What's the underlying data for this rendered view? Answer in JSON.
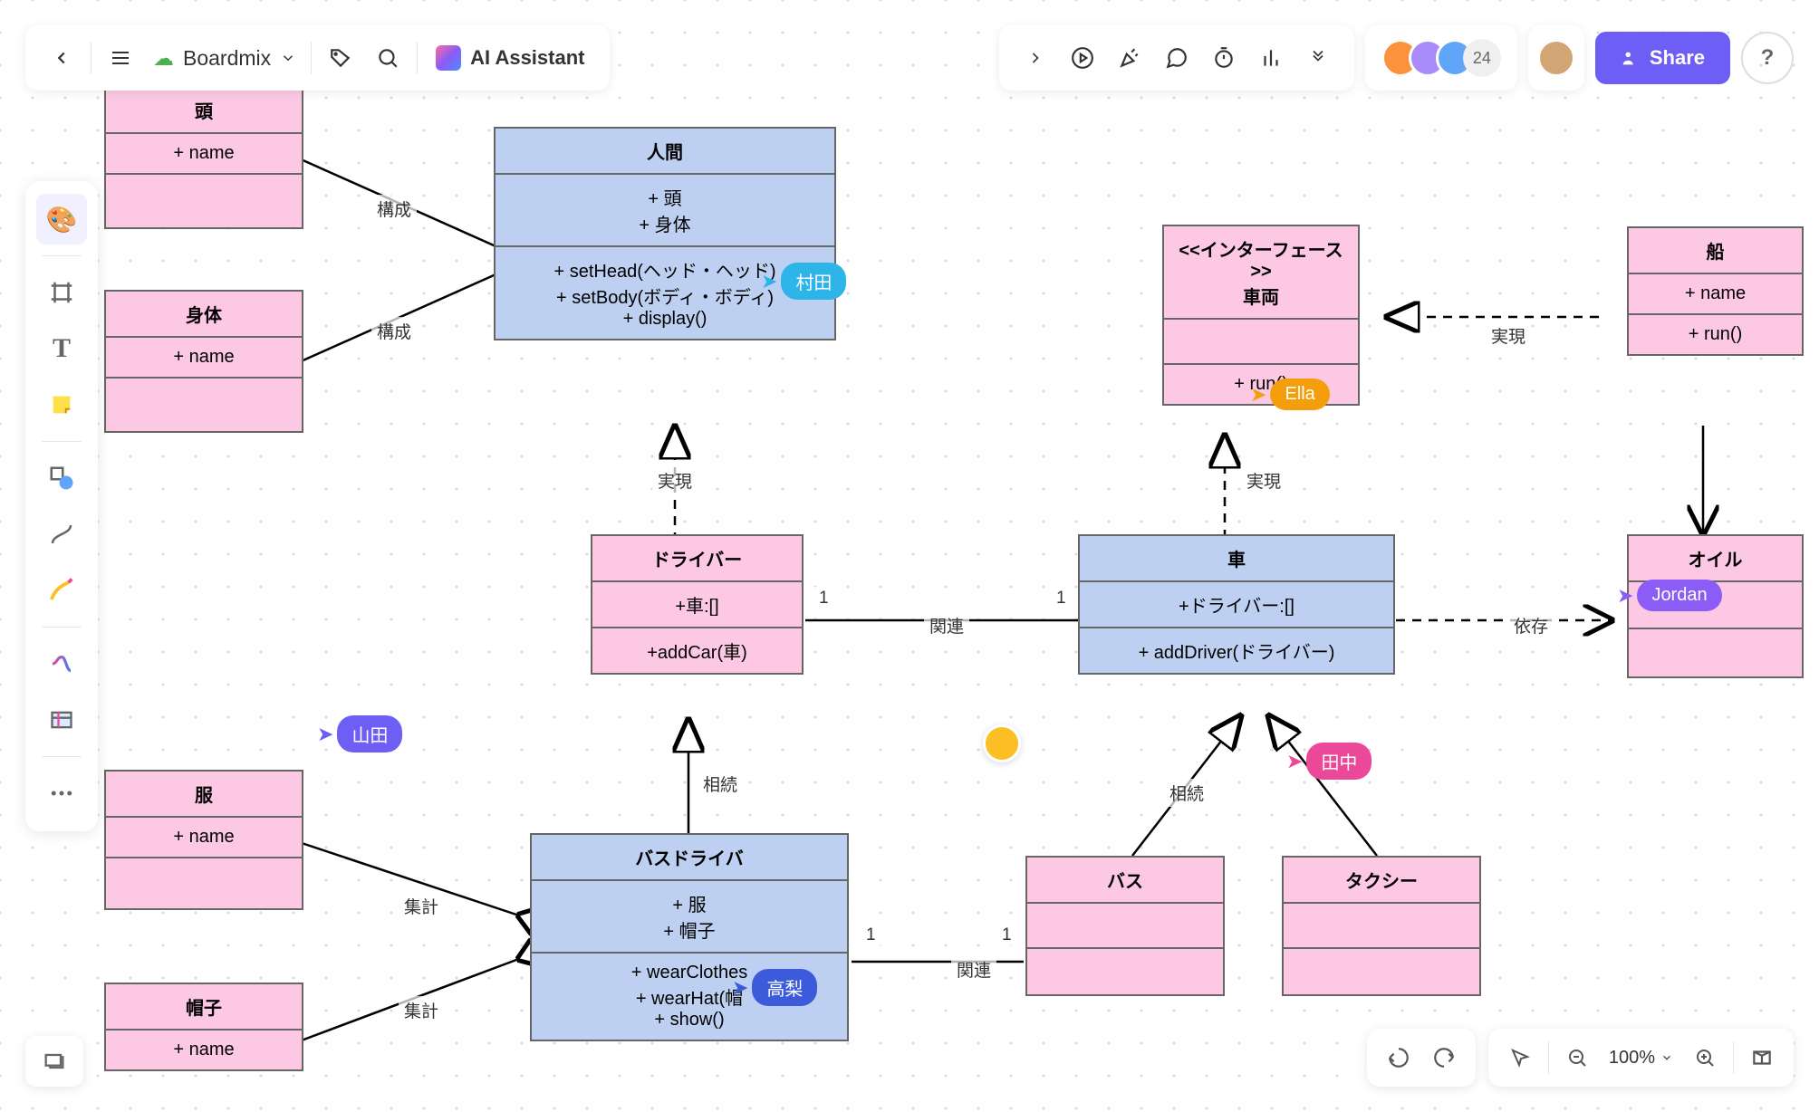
{
  "app": {
    "title": "Boardmix",
    "ai": "AI Assistant",
    "share": "Share",
    "collab_count": "24",
    "zoom": "100%"
  },
  "nodes": {
    "head": {
      "title": "頭",
      "attr": "+ name"
    },
    "body": {
      "title": "身体",
      "attr": "+ name"
    },
    "human": {
      "title": "人間",
      "attrs": "+ 頭\n+ 身体",
      "methods": "+ setHead(ヘッド・ヘッド)\n+ setBody(ボディ・ボディ)\n+ display()"
    },
    "vehicle_if": {
      "stereo": "<<インターフェース>>",
      "title": "車両",
      "method": "+ run()"
    },
    "ship": {
      "title": "船",
      "attr": "+ name",
      "method": "+ run()"
    },
    "driver": {
      "title": "ドライバー",
      "attr": "+車:[]",
      "method": "+addCar(車)"
    },
    "car": {
      "title": "車",
      "attr": "+ドライバー:[]",
      "method": "+ addDriver(ドライバー)"
    },
    "oil": {
      "title": "オイル"
    },
    "clothes": {
      "title": "服",
      "attr": "+ name"
    },
    "hat": {
      "title": "帽子",
      "attr": "+ name"
    },
    "busdriver": {
      "title": "バスドライバ",
      "attrs": "+ 服\n+ 帽子",
      "methods": "+ wearClothes\n+ wearHat(帽\n+ show()"
    },
    "bus": {
      "title": "バス"
    },
    "taxi": {
      "title": "タクシー"
    }
  },
  "labels": {
    "compose": "構成",
    "realize": "実現",
    "assoc": "関連",
    "depend": "依存",
    "inherit": "相続",
    "aggregate": "集計",
    "one": "1"
  },
  "cursors": {
    "murata": "村田",
    "ella": "Ella",
    "yamada": "山田",
    "jordan": "Jordan",
    "tanaka": "田中",
    "takanashi": "高梨"
  },
  "chart_data": {
    "type": "uml-class-diagram",
    "classes": [
      {
        "name": "頭",
        "attrs": [
          "+ name"
        ],
        "color": "pink"
      },
      {
        "name": "身体",
        "attrs": [
          "+ name"
        ],
        "color": "pink"
      },
      {
        "name": "人間",
        "attrs": [
          "+ 頭",
          "+ 身体"
        ],
        "methods": [
          "+ setHead(ヘッド・ヘッド)",
          "+ setBody(ボディ・ボディ)",
          "+ display()"
        ],
        "color": "blue"
      },
      {
        "name": "車両",
        "stereotype": "<<インターフェース>>",
        "methods": [
          "+ run()"
        ],
        "color": "pink"
      },
      {
        "name": "船",
        "attrs": [
          "+ name"
        ],
        "methods": [
          "+ run()"
        ],
        "color": "pink"
      },
      {
        "name": "ドライバー",
        "attrs": [
          "+車:[]"
        ],
        "methods": [
          "+addCar(車)"
        ],
        "color": "pink"
      },
      {
        "name": "車",
        "attrs": [
          "+ドライバー:[]"
        ],
        "methods": [
          "+ addDriver(ドライバー)"
        ],
        "color": "blue"
      },
      {
        "name": "オイル",
        "color": "pink"
      },
      {
        "name": "服",
        "attrs": [
          "+ name"
        ],
        "color": "pink"
      },
      {
        "name": "帽子",
        "attrs": [
          "+ name"
        ],
        "color": "pink"
      },
      {
        "name": "バスドライバ",
        "attrs": [
          "+ 服",
          "+ 帽子"
        ],
        "methods": [
          "+ wearClothes",
          "+ wearHat(帽",
          "+ show()"
        ],
        "color": "blue"
      },
      {
        "name": "バス",
        "color": "pink"
      },
      {
        "name": "タクシー",
        "color": "pink"
      }
    ],
    "relationships": [
      {
        "from": "頭",
        "to": "人間",
        "type": "composition",
        "label": "構成"
      },
      {
        "from": "身体",
        "to": "人間",
        "type": "composition",
        "label": "構成"
      },
      {
        "from": "ドライバー",
        "to": "人間",
        "type": "realization",
        "label": "実現"
      },
      {
        "from": "ドライバー",
        "to": "車",
        "type": "association",
        "label": "関連",
        "mult_from": "1",
        "mult_to": "1"
      },
      {
        "from": "車",
        "to": "車両",
        "type": "realization",
        "label": "実現"
      },
      {
        "from": "船",
        "to": "車両",
        "type": "realization",
        "label": "実現"
      },
      {
        "from": "車",
        "to": "オイル",
        "type": "dependency",
        "label": "依存"
      },
      {
        "from": "船",
        "to": "オイル",
        "type": "association"
      },
      {
        "from": "バスドライバ",
        "to": "ドライバー",
        "type": "inheritance",
        "label": "相続"
      },
      {
        "from": "バス",
        "to": "車",
        "type": "inheritance",
        "label": "相続"
      },
      {
        "from": "タクシー",
        "to": "車",
        "type": "inheritance",
        "label": "相続"
      },
      {
        "from": "服",
        "to": "バスドライバ",
        "type": "aggregation",
        "label": "集計"
      },
      {
        "from": "帽子",
        "to": "バスドライバ",
        "type": "aggregation",
        "label": "集計"
      },
      {
        "from": "バスドライバ",
        "to": "バス",
        "type": "association",
        "label": "関連",
        "mult_from": "1",
        "mult_to": "1"
      }
    ]
  }
}
